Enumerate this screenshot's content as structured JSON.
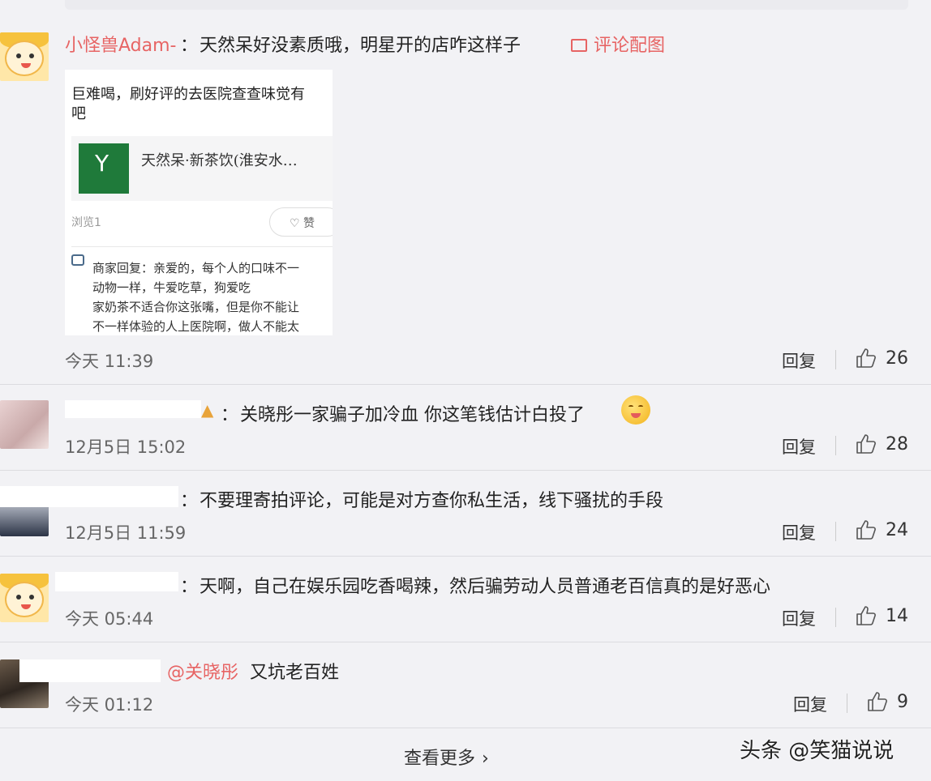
{
  "comments": [
    {
      "username": "小怪兽Adam-",
      "text": "天然呆好没素质哦，明星开的店咋这样子",
      "image_link_label": "评论配图",
      "time": "今天 11:39",
      "reply_label": "回复",
      "likes": "26"
    },
    {
      "text": "关晓彤一家骗子加冷血  你这笔钱估计白投了",
      "time": "12月5日 15:02",
      "reply_label": "回复",
      "likes": "28"
    },
    {
      "text": "不要理寄拍评论，可能是对方查你私生活，线下骚扰的手段",
      "time": "12月5日 11:59",
      "reply_label": "回复",
      "likes": "24"
    },
    {
      "text": "天啊，自己在娱乐园吃香喝辣，然后骗劳动人员普通老百信真的是好恶心",
      "time": "今天 05:44",
      "reply_label": "回复",
      "likes": "14"
    },
    {
      "mention": "@关晓彤",
      "text": "又坑老百姓",
      "time": "今天 01:12",
      "reply_label": "回复",
      "likes": "9"
    }
  ],
  "embedded_image": {
    "line1": "巨难喝，刷好评的去医院查查味觉有",
    "line2": "吧",
    "shop_name": "天然呆·新茶饮(淮安水…",
    "views": "浏览1",
    "like_label": "赞",
    "reply_lines": [
      "商家回复：亲爱的，每个人的口味不一",
      "动物一样，牛爱吃草，狗爱吃",
      "家奶茶不适合你这张嘴，但是你不能让",
      "不一样体验的人上医院啊，做人不能太"
    ]
  },
  "more_label": "查看更多",
  "watermark": "头条 @笑猫说说"
}
